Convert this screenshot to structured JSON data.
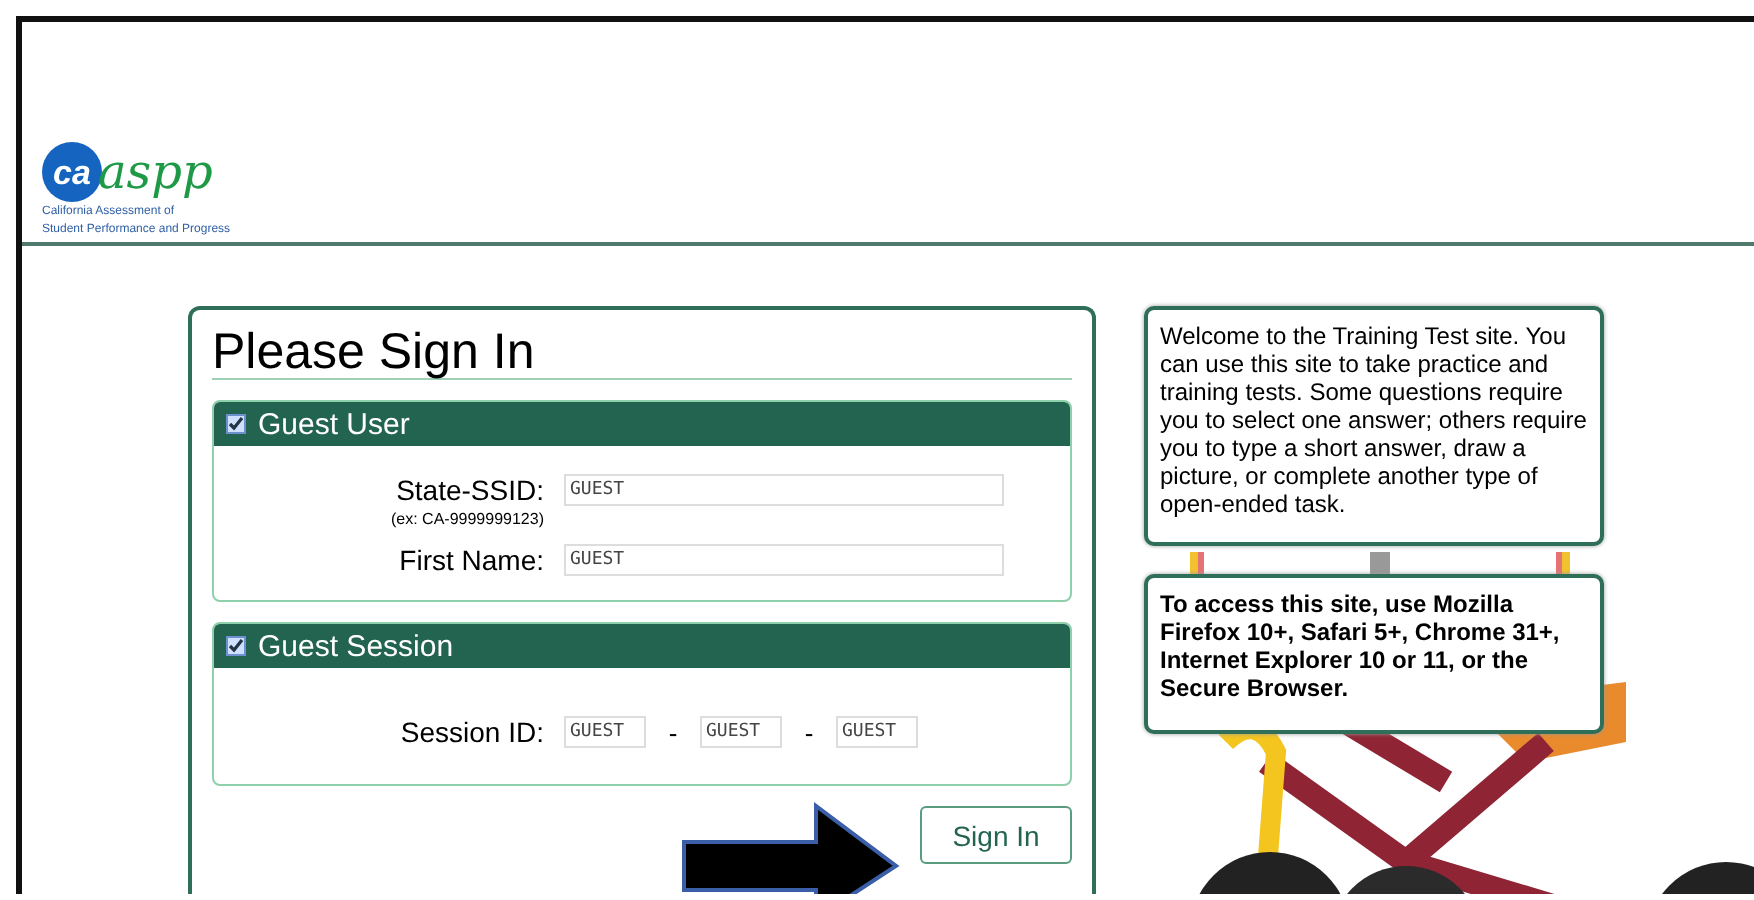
{
  "logo": {
    "monogram": "ca",
    "wordmark": "aspp",
    "caption": [
      "California Assessment of",
      "Student Performance and Progress"
    ]
  },
  "signin": {
    "title": "Please Sign In",
    "sections": [
      {
        "title": "Guest User",
        "fields": [
          {
            "kind": "single",
            "label": "State-SSID:",
            "hint": "(ex: CA-9999999123)",
            "values": [
              "GUEST"
            ]
          },
          {
            "kind": "single",
            "label": "First Name:",
            "values": [
              "GUEST"
            ]
          }
        ]
      },
      {
        "title": "Guest Session",
        "fields": [
          {
            "kind": "split",
            "label": "Session ID:",
            "separator": "-",
            "values": [
              "GUEST",
              "GUEST",
              "GUEST"
            ]
          }
        ]
      }
    ],
    "button": "Sign In"
  },
  "info": [
    {
      "kind": "plain",
      "text": "Welcome to the Training Test site. You can use this site to take practice and training tests. Some questions require you to select one answer; others require you to type a short answer, draw a picture, or complete another type of open-ended task."
    },
    {
      "kind": "bold",
      "text": "To access this site, use Mozilla Firefox 10+, Safari 5+, Chrome 31+, Internet Explorer 10 or 11, or the Secure Browser."
    }
  ]
}
